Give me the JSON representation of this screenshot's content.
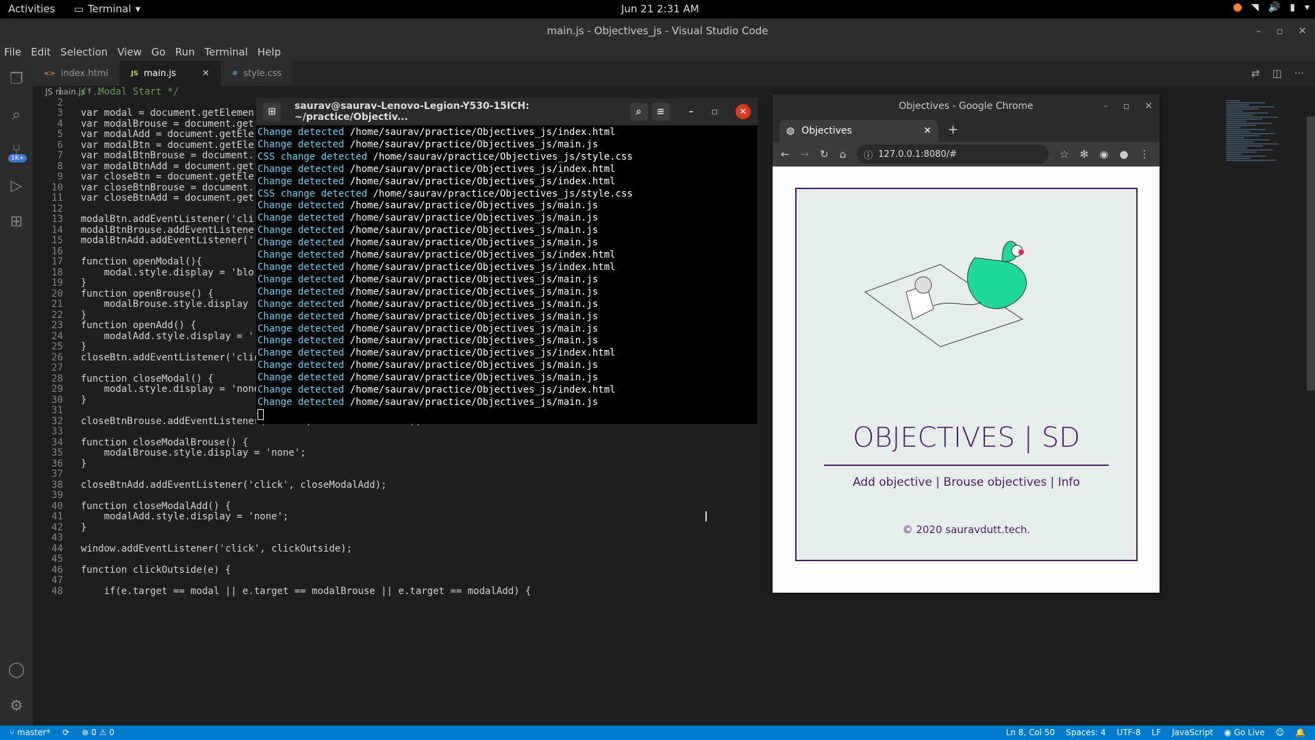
{
  "topbar": {
    "activities": "Activities",
    "app": "Terminal",
    "clock": "Jun 21  2:31 AM"
  },
  "window_title": "main.js - Objectives_js - Visual Studio Code",
  "menu": [
    "File",
    "Edit",
    "Selection",
    "View",
    "Go",
    "Run",
    "Terminal",
    "Help"
  ],
  "tabs": [
    {
      "label": "index.html",
      "icon": "<>"
    },
    {
      "label": "main.js",
      "icon": "JS"
    },
    {
      "label": "style.css",
      "icon": "#"
    }
  ],
  "breadcrumb": "JS  main.js  ›  ...",
  "code": [
    "/* Modal Start */",
    "",
    "var modal = document.getElemen",
    "var modalBrouse = document.get",
    "var modalAdd = document.getEle",
    "var modalBtn = document.getEle",
    "var modalBtnBrouse = document.",
    "var modalBtnAdd = document.get",
    "var closeBtn = document.getEle",
    "var closeBtnBrouse = document.",
    "var closeBtnAdd = document.get",
    "",
    "modalBtn.addEventListener('cli",
    "modalBtnBrouse.addEventListene",
    "modalBtnAdd.addEventListener('",
    "",
    "function openModal(){",
    "    modal.style.display = 'blo",
    "}",
    "function openBrouse() {",
    "    modalBrouse.style.display",
    "}",
    "function openAdd() {",
    "    modalAdd.style.display = '",
    "}",
    "closeBtn.addEventListener('click', closeModal);",
    "",
    "function closeModal() {",
    "    modal.style.display = 'none';",
    "}",
    "",
    "closeBtnBrouse.addEventListener('click', closeModalBrouse);",
    "",
    "function closeModalBrouse() {",
    "    modalBrouse.style.display = 'none';",
    "}",
    "",
    "closeBtnAdd.addEventListener('click', closeModalAdd);",
    "",
    "function closeModalAdd() {",
    "    modalAdd.style.display = 'none';",
    "}",
    "",
    "window.addEventListener('click', clickOutside);",
    "",
    "function clickOutside(e) {",
    "",
    "    if(e.target == modal || e.target == modalBrouse || e.target == modalAdd) {"
  ],
  "terminal": {
    "title": "saurav@saurav-Lenovo-Legion-Y530-15ICH: ~/practice/Objectiv...",
    "lines": [
      [
        "Change detected",
        "/home/saurav/practice/Objectives_js/index.html"
      ],
      [
        "Change detected",
        "/home/saurav/practice/Objectives_js/main.js"
      ],
      [
        "CSS change detected",
        "/home/saurav/practice/Objectives_js/style.css"
      ],
      [
        "Change detected",
        "/home/saurav/practice/Objectives_js/index.html"
      ],
      [
        "Change detected",
        "/home/saurav/practice/Objectives_js/index.html"
      ],
      [
        "CSS change detected",
        "/home/saurav/practice/Objectives_js/style.css"
      ],
      [
        "Change detected",
        "/home/saurav/practice/Objectives_js/main.js"
      ],
      [
        "Change detected",
        "/home/saurav/practice/Objectives_js/main.js"
      ],
      [
        "Change detected",
        "/home/saurav/practice/Objectives_js/main.js"
      ],
      [
        "Change detected",
        "/home/saurav/practice/Objectives_js/main.js"
      ],
      [
        "Change detected",
        "/home/saurav/practice/Objectives_js/index.html"
      ],
      [
        "Change detected",
        "/home/saurav/practice/Objectives_js/index.html"
      ],
      [
        "Change detected",
        "/home/saurav/practice/Objectives_js/main.js"
      ],
      [
        "Change detected",
        "/home/saurav/practice/Objectives_js/main.js"
      ],
      [
        "Change detected",
        "/home/saurav/practice/Objectives_js/main.js"
      ],
      [
        "Change detected",
        "/home/saurav/practice/Objectives_js/main.js"
      ],
      [
        "Change detected",
        "/home/saurav/practice/Objectives_js/main.js"
      ],
      [
        "Change detected",
        "/home/saurav/practice/Objectives_js/main.js"
      ],
      [
        "Change detected",
        "/home/saurav/practice/Objectives_js/index.html"
      ],
      [
        "Change detected",
        "/home/saurav/practice/Objectives_js/main.js"
      ],
      [
        "Change detected",
        "/home/saurav/practice/Objectives_js/main.js"
      ],
      [
        "Change detected",
        "/home/saurav/practice/Objectives_js/index.html"
      ],
      [
        "Change detected",
        "/home/saurav/practice/Objectives_js/main.js"
      ]
    ]
  },
  "chrome": {
    "title": "Objectives - Google Chrome",
    "tab": "Objectives",
    "url": "127.0.0.1:8080/#"
  },
  "site": {
    "heading": "OBJECTIVES | SD",
    "nav": "Add objective | Brouse objectives | Info",
    "footer": "© 2020 sauravdutt.tech."
  },
  "status": {
    "branch": "master*",
    "errors": "0",
    "warnings": "0",
    "position": "Ln 8, Col 50",
    "spaces": "Spaces: 4",
    "encoding": "UTF-8",
    "eol": "LF",
    "language": "JavaScript",
    "golive": "Go Live"
  },
  "colors": {
    "accent": "#007acc",
    "site_purple": "#4d1a6b",
    "terminal_bg": "#000000"
  }
}
